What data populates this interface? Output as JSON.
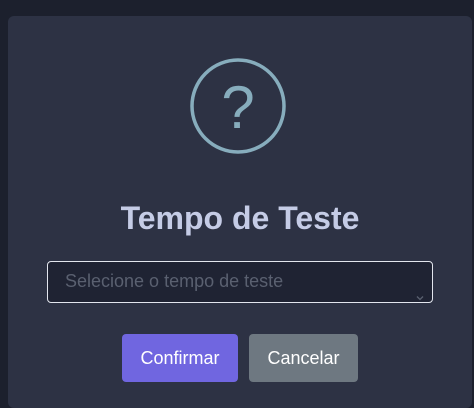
{
  "dialog": {
    "icon": "question-mark-icon",
    "icon_glyph": "?",
    "icon_color": "#87adbd",
    "title": "Tempo de Teste",
    "select": {
      "placeholder": "Selecione o tempo de teste",
      "icon": "chevron-down-icon"
    },
    "buttons": {
      "confirm": "Confirmar",
      "cancel": "Cancelar"
    }
  },
  "colors": {
    "modal_background": "#2d3244",
    "confirm_button": "#7066e0",
    "cancel_button": "#6e7881",
    "title_text": "#c5cce6"
  }
}
